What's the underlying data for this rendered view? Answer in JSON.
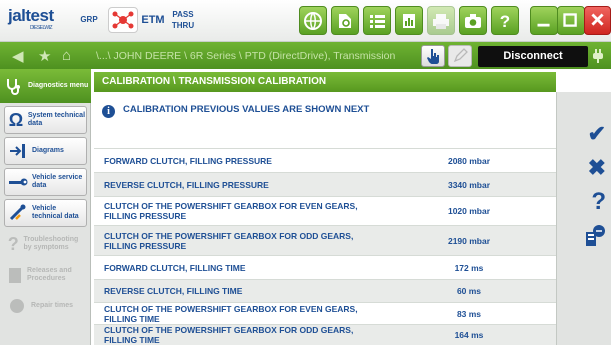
{
  "app": {
    "logo": "jaltest",
    "logo_sub": "DIESELWIZ"
  },
  "toolbar": {
    "grp_label": "GRP",
    "etm_label": "ETM",
    "pass_label_line1": "PASS",
    "pass_label_line2": "THRU"
  },
  "breadcrumb": "\\...\\ JOHN DEERE \\ 6R Series \\ PTD (DirectDrive), Transmission",
  "disconnect_label": "Disconnect",
  "sidebar": {
    "diagnostics": "Diagnostics menu",
    "items": [
      {
        "label": "System technical data",
        "icon": "omega-icon",
        "enabled": true
      },
      {
        "label": "Diagrams",
        "icon": "diagram-icon",
        "enabled": true
      },
      {
        "label": "Vehicle service data",
        "icon": "wrench-icon",
        "enabled": true
      },
      {
        "label": "Vehicle technical data",
        "icon": "wrench-pencil-icon",
        "enabled": true
      },
      {
        "label": "Troubleshooting by symptoms",
        "icon": "troubleshoot-icon",
        "enabled": false
      },
      {
        "label": "Releases and Procedures",
        "icon": "releases-icon",
        "enabled": false
      },
      {
        "label": "Repair times",
        "icon": "repair-icon",
        "enabled": false
      }
    ]
  },
  "page": {
    "header": "CALIBRATION \\ TRANSMISSION CALIBRATION",
    "info": "CALIBRATION PREVIOUS VALUES ARE SHOWN NEXT",
    "rows": [
      {
        "name": "FORWARD CLUTCH, FILLING PRESSURE",
        "value": "2080 mbar"
      },
      {
        "name": "REVERSE CLUTCH, FILLING PRESSURE",
        "value": "3340 mbar"
      },
      {
        "name": "CLUTCH OF THE POWERSHIFT GEARBOX FOR EVEN GEARS, FILLING PRESSURE",
        "value": "1020 mbar"
      },
      {
        "name": "CLUTCH OF THE POWERSHIFT GEARBOX FOR ODD GEARS, FILLING PRESSURE",
        "value": "2190 mbar"
      },
      {
        "name": "FORWARD CLUTCH, FILLING TIME",
        "value": "172 ms"
      },
      {
        "name": "REVERSE CLUTCH, FILLING TIME",
        "value": "60 ms"
      },
      {
        "name": "CLUTCH OF THE POWERSHIFT GEARBOX FOR EVEN GEARS, FILLING TIME",
        "value": "83 ms"
      },
      {
        "name": "CLUTCH OF THE POWERSHIFT GEARBOX FOR ODD GEARS, FILLING TIME",
        "value": "164 ms"
      }
    ]
  },
  "rightbar": {
    "ok": "✔",
    "cancel": "✖",
    "help": "?"
  },
  "colors": {
    "accent": "#5aa123",
    "text": "#1e4f95",
    "close": "#e53935"
  }
}
